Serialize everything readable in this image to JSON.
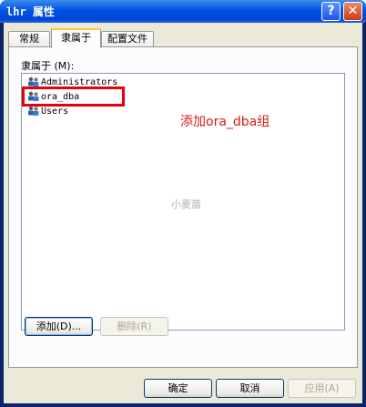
{
  "window": {
    "title": "lhr 属性",
    "help_glyph": "?",
    "close_glyph": "✕"
  },
  "tabs": [
    {
      "label": "常规"
    },
    {
      "label": "隶属于"
    },
    {
      "label": "配置文件"
    }
  ],
  "member_of": {
    "label": "隶属于 (M):",
    "items": [
      {
        "name": "Administrators",
        "icon": "group-icon"
      },
      {
        "name": "ora_dba",
        "icon": "group-icon"
      },
      {
        "name": "Users",
        "icon": "group-icon"
      }
    ]
  },
  "annotation": {
    "text": "添加ora_dba组",
    "color": "#d81b1b"
  },
  "watermark": "小麦苗",
  "buttons": {
    "add": "添加(D)...",
    "remove": "删除(R)",
    "ok": "确定",
    "cancel": "取消",
    "apply": "应用(A)"
  },
  "colors": {
    "title_bar": "#0054e3",
    "highlight_box": "#e8000b",
    "dialog_face": "#ece9d8"
  }
}
